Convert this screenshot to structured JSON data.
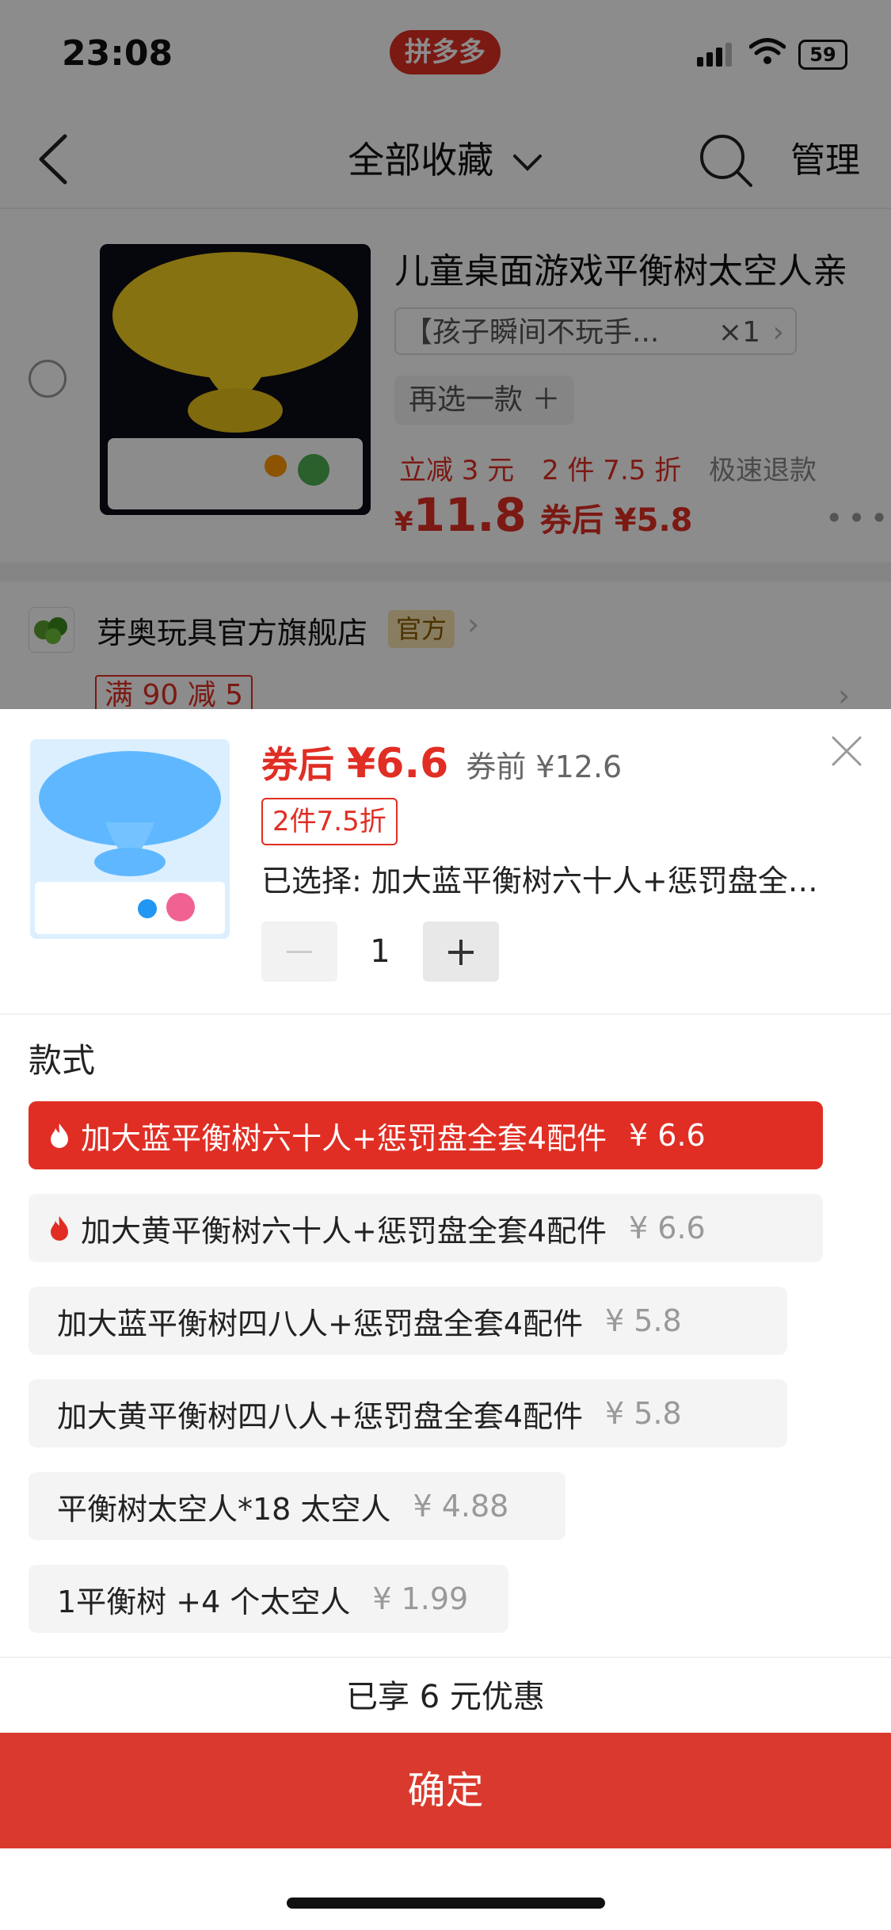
{
  "status": {
    "time": "23:08",
    "app_badge": "拼多多",
    "battery": "59"
  },
  "nav": {
    "title": "全部收藏",
    "manage": "管理"
  },
  "item": {
    "title": "儿童桌面游戏平衡树太空人亲",
    "spec": "【孩子瞬间不玩手...",
    "qty": "×1",
    "reselect": "再选一款 ＋",
    "tag1": "立减 3 元",
    "tag2": "2 件 7.5 折",
    "tag3": "极速退款",
    "price_symbol": "¥",
    "price": "11.8",
    "after_coupon": "券后 ¥5.8"
  },
  "shop": {
    "name": "芽奥玩具官方旗舰店",
    "official": "官方",
    "coupon": "满 90 减 5"
  },
  "sheet": {
    "price_label": "券后 ",
    "price_value": "¥6.6",
    "original": "券前 ¥12.6",
    "discount": "2件7.5折",
    "selected": "已选择: 加大蓝平衡树六十人+惩罚盘全套4配件",
    "quantity": "1",
    "section": "款式",
    "options": [
      {
        "label": "加大蓝平衡树六十人+惩罚盘全套4配件",
        "price": "¥ 6.6",
        "hot": true,
        "selected": true
      },
      {
        "label": "加大黄平衡树六十人+惩罚盘全套4配件",
        "price": "¥ 6.6",
        "hot": true,
        "selected": false
      },
      {
        "label": "加大蓝平衡树四八人+惩罚盘全套4配件",
        "price": "¥ 5.8",
        "hot": false,
        "selected": false
      },
      {
        "label": "加大黄平衡树四八人+惩罚盘全套4配件",
        "price": "¥ 5.8",
        "hot": false,
        "selected": false
      },
      {
        "label": "平衡树太空人*18 太空人",
        "price": "¥ 4.88",
        "hot": false,
        "selected": false
      },
      {
        "label": "1平衡树 +4 个太空人",
        "price": "¥ 1.99",
        "hot": false,
        "selected": false
      }
    ],
    "promo": "已享 6 元优惠",
    "confirm": "确定"
  },
  "colors": {
    "accent": "#e02e24",
    "confirm": "#da3a2d"
  }
}
